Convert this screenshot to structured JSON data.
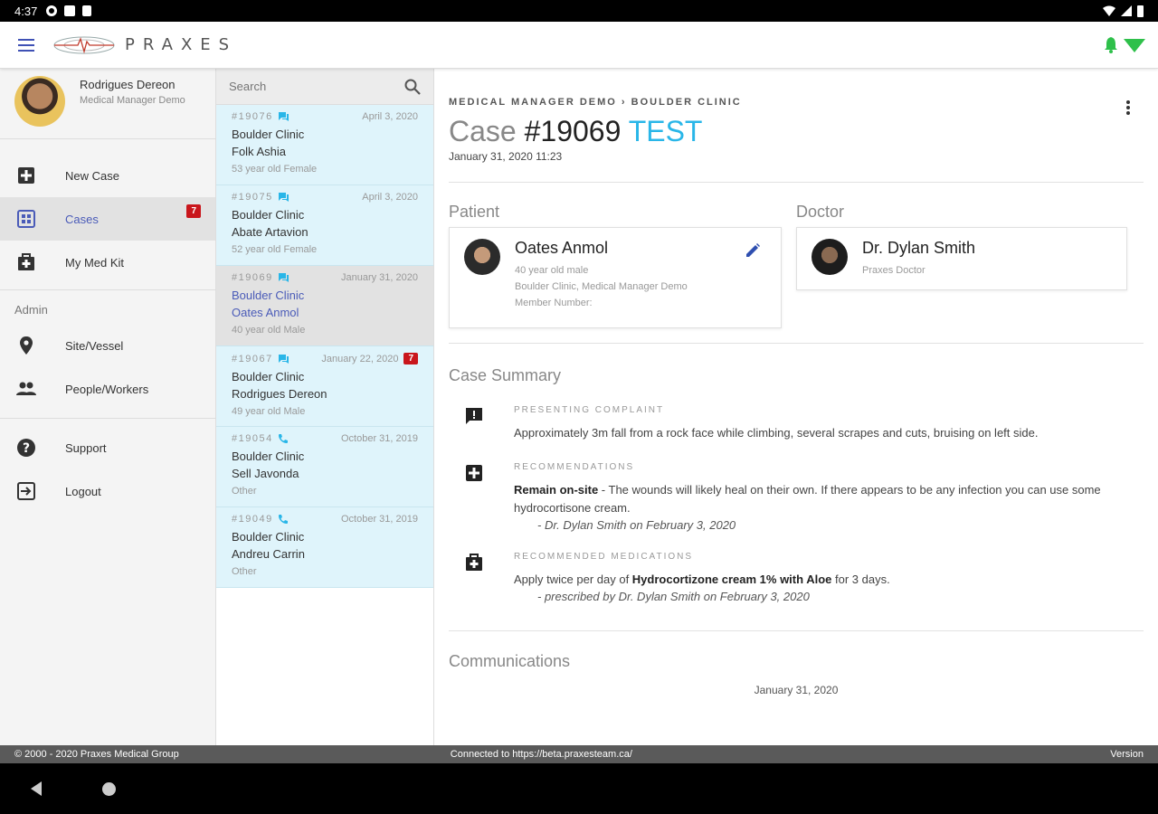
{
  "status_bar": {
    "time": "4:37"
  },
  "app": {
    "logo_text": "PRAXES",
    "accent": "#29b6e8",
    "nav_active_color": "#4a5bb8",
    "badge_color": "#c9161c",
    "alert_color": "#2ec04a"
  },
  "profile": {
    "name": "Rodrigues Dereon",
    "role": "Medical Manager Demo"
  },
  "nav": {
    "new_case": "New Case",
    "cases": "Cases",
    "cases_badge": "7",
    "med_kit": "My Med Kit",
    "admin_section": "Admin",
    "site_vessel": "Site/Vessel",
    "people_workers": "People/Workers",
    "support": "Support",
    "logout": "Logout"
  },
  "search": {
    "placeholder": "Search"
  },
  "cases": [
    {
      "num": "#19076",
      "type": "chat",
      "date": "April 3, 2020",
      "clinic": "Boulder Clinic",
      "patient": "Folk Ashia",
      "desc": "53 year old Female",
      "badge": ""
    },
    {
      "num": "#19075",
      "type": "chat",
      "date": "April 3, 2020",
      "clinic": "Boulder Clinic",
      "patient": "Abate Artavion",
      "desc": "52 year old Female",
      "badge": ""
    },
    {
      "num": "#19069",
      "type": "chat",
      "date": "January 31, 2020",
      "clinic": "Boulder Clinic",
      "patient": "Oates Anmol",
      "desc": "40 year old Male",
      "badge": ""
    },
    {
      "num": "#19067",
      "type": "chat",
      "date": "January 22, 2020",
      "clinic": "Boulder Clinic",
      "patient": "Rodrigues Dereon",
      "desc": "49 year old Male",
      "badge": "7"
    },
    {
      "num": "#19054",
      "type": "phone",
      "date": "October 31, 2019",
      "clinic": "Boulder Clinic",
      "patient": "Sell Javonda",
      "desc": "Other",
      "badge": ""
    },
    {
      "num": "#19049",
      "type": "phone",
      "date": "October 31, 2019",
      "clinic": "Boulder Clinic",
      "patient": "Andreu Carrin",
      "desc": "Other",
      "badge": ""
    }
  ],
  "detail": {
    "breadcrumb": "MEDICAL MANAGER DEMO  ›  BOULDER CLINIC",
    "title_prefix": "Case",
    "title_num": "#19069",
    "title_tag": "TEST",
    "datetime": "January 31, 2020 11:23",
    "patient_label": "Patient",
    "doctor_label": "Doctor",
    "patient": {
      "name": "Oates Anmol",
      "age": "40 year old male",
      "org": "Boulder Clinic, Medical Manager Demo",
      "member": "Member Number:"
    },
    "doctor": {
      "name": "Dr. Dylan Smith",
      "role": "Praxes Doctor"
    },
    "summary_label": "Case Summary",
    "complaint_head": "PRESENTING COMPLAINT",
    "complaint_text": "Approximately 3m fall from a rock face while climbing, several scrapes and cuts, bruising on left side.",
    "rec_head": "RECOMMENDATIONS",
    "rec_bold": "Remain on-site",
    "rec_text": " - The wounds will likely heal on their own. If there appears to be any infection you can use some hydrocortisone cream.",
    "rec_by": "- Dr. Dylan Smith on February 3, 2020",
    "med_head": "RECOMMENDED MEDICATIONS",
    "med_pre": "Apply twice per day of ",
    "med_bold": "Hydrocortizone cream 1% with Aloe",
    "med_post": " for 3 days.",
    "med_by": "- prescribed by Dr. Dylan Smith on February 3, 2020",
    "comm_label": "Communications",
    "comm_date": "January 31, 2020"
  },
  "footer": {
    "copyright": "© 2000 - 2020 Praxes Medical Group",
    "connected": "Connected to https://beta.praxesteam.ca/",
    "version": "Version"
  }
}
